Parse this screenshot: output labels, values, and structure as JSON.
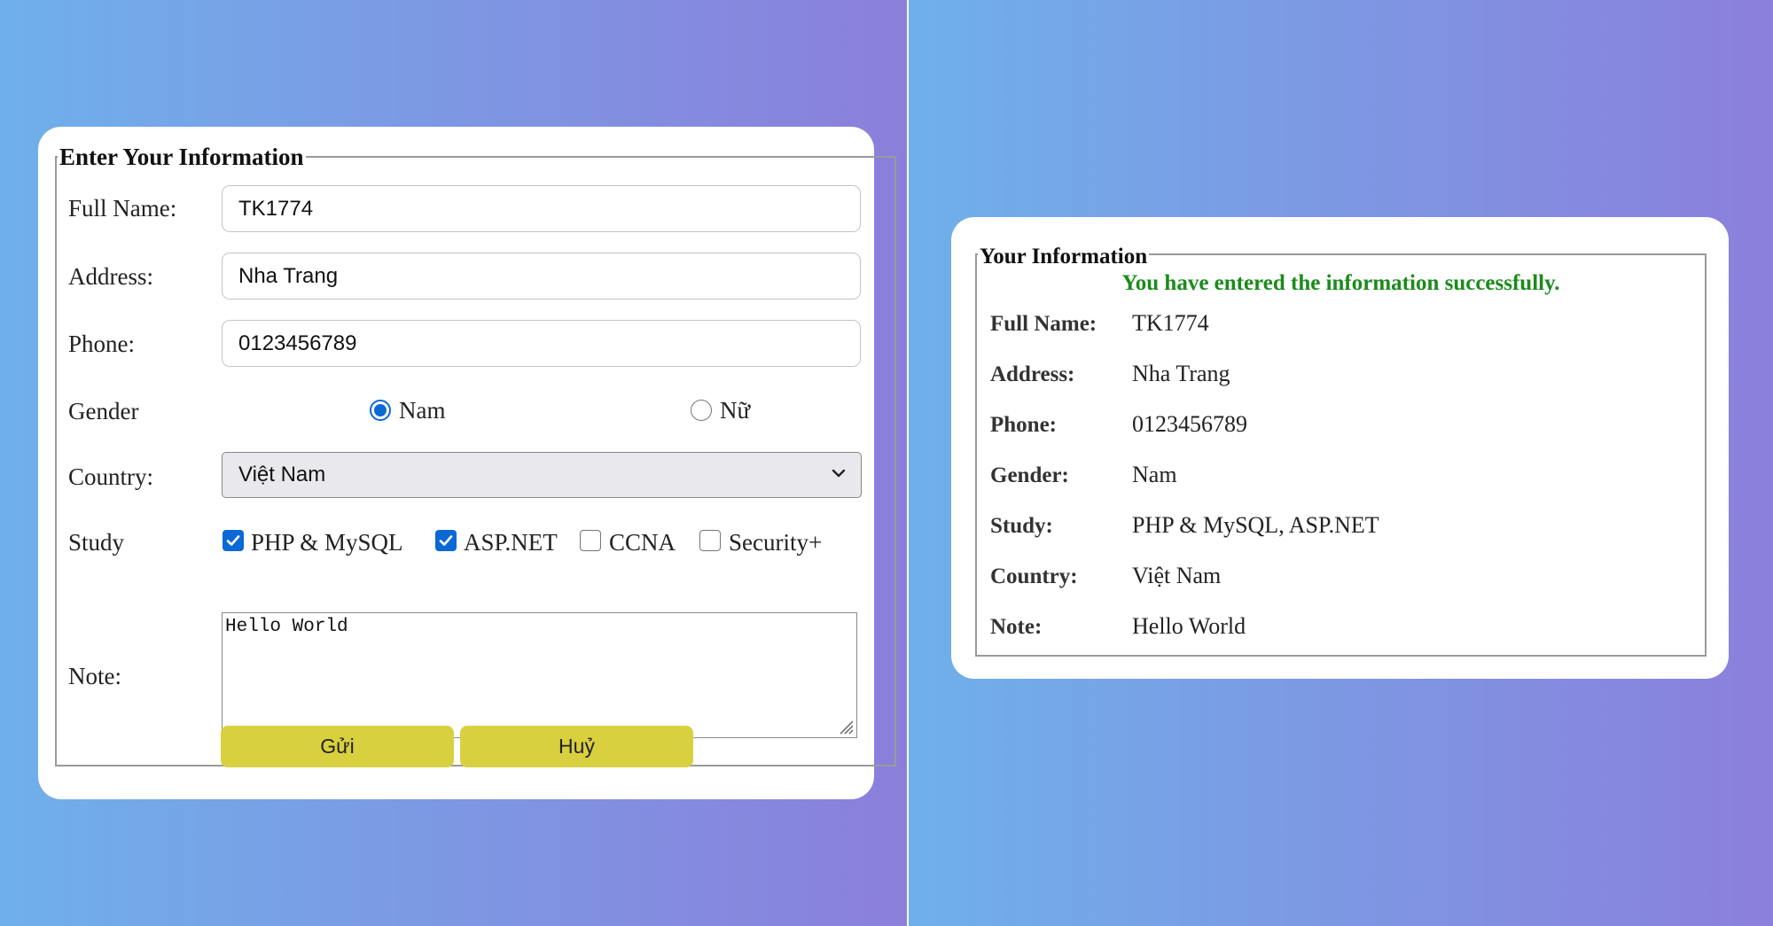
{
  "form": {
    "legend": "Enter Your Information",
    "fullname": {
      "label": "Full Name:",
      "value": "TK1774"
    },
    "address": {
      "label": "Address:",
      "value": "Nha Trang"
    },
    "phone": {
      "label": "Phone:",
      "value": "0123456789"
    },
    "gender": {
      "label": "Gender",
      "options": [
        "Nam",
        "Nữ"
      ],
      "selected": "Nam"
    },
    "country": {
      "label": "Country:",
      "value": "Việt Nam"
    },
    "study": {
      "label": "Study",
      "options": [
        {
          "label": "PHP & MySQL",
          "checked": true
        },
        {
          "label": "ASP.NET",
          "checked": true
        },
        {
          "label": "CCNA",
          "checked": false
        },
        {
          "label": "Security+",
          "checked": false
        }
      ]
    },
    "note": {
      "label": "Note:",
      "value": "Hello World"
    },
    "submit_label": "Gửi",
    "cancel_label": "Huỷ",
    "button_color": "#d9d03f",
    "accent_color": "#0b69d6"
  },
  "result": {
    "legend": "Your Information",
    "message": "You have entered the information successfully.",
    "message_color": "#1b8b1b",
    "rows": [
      {
        "key": "Full Name:",
        "value": "TK1774"
      },
      {
        "key": "Address:",
        "value": "Nha Trang"
      },
      {
        "key": "Phone:",
        "value": "0123456789"
      },
      {
        "key": "Gender:",
        "value": "Nam"
      },
      {
        "key": "Study:",
        "value": "PHP & MySQL, ASP.NET"
      },
      {
        "key": "Country:",
        "value": "Việt Nam"
      },
      {
        "key": "Note:",
        "value": "Hello World"
      }
    ]
  },
  "background": {
    "gradient_start": "#6fb0ea",
    "gradient_end": "#8b7fdc"
  }
}
